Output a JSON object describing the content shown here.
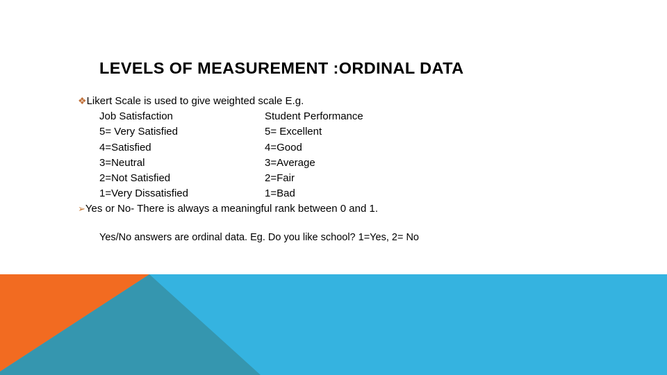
{
  "slide": {
    "title": "LEVELS OF MEASUREMENT :ORDINAL DATA",
    "bullets": {
      "likert": {
        "glyph": "❖",
        "glyph_name": "diamond-cluster-bullet",
        "text": "Likert Scale is used to give weighted scale E.g."
      },
      "yesno": {
        "glyph": "➢",
        "glyph_name": "arrowhead-bullet",
        "text": "Yes or No- There is always a meaningful rank between 0 and 1."
      }
    },
    "scale_table": {
      "headers": [
        "Job Satisfaction",
        "Student Performance"
      ],
      "rows": [
        [
          "5= Very Satisfied",
          "5= Excellent"
        ],
        [
          "4=Satisfied",
          "4=Good"
        ],
        [
          "3=Neutral",
          "3=Average"
        ],
        [
          "2=Not Satisfied",
          "2=Fair"
        ],
        [
          "1=Very Dissatisfied",
          "1=Bad"
        ]
      ]
    },
    "closing_text": "Yes/No answers are ordinal data. Eg. Do you like school? 1=Yes, 2= No",
    "theme": {
      "orange": "#F26B21",
      "teal": "#3596AF",
      "light_blue": "#35B3E0",
      "bullet_orange": "#C0703A",
      "text_black": "#000000",
      "background": "#FFFFFF"
    }
  }
}
